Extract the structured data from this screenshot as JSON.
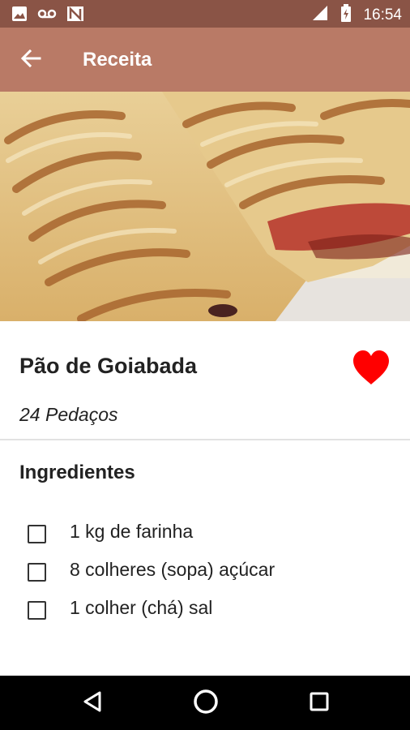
{
  "status_bar": {
    "time": "16:54",
    "left_icons": [
      "image-icon",
      "voicemail-icon",
      "n-icon"
    ],
    "right_icons": [
      "signal-icon",
      "battery-icon"
    ]
  },
  "app_bar": {
    "title": "Receita",
    "back_icon": "arrow-back-icon",
    "background": "#b97a66"
  },
  "recipe": {
    "title": "Pão de Goiabada",
    "servings": "24 Pedaços",
    "favorite": true,
    "favorite_color": "#ff0000"
  },
  "ingredients": {
    "section_title": "Ingredientes",
    "items": [
      {
        "label": "1 kg de farinha",
        "checked": false
      },
      {
        "label": "8 colheres (sopa) açúcar",
        "checked": false
      },
      {
        "label": "1 colher (chá) sal",
        "checked": false
      }
    ]
  },
  "nav_bar": {
    "buttons": [
      "back-triangle-icon",
      "home-circle-icon",
      "recents-square-icon"
    ]
  }
}
